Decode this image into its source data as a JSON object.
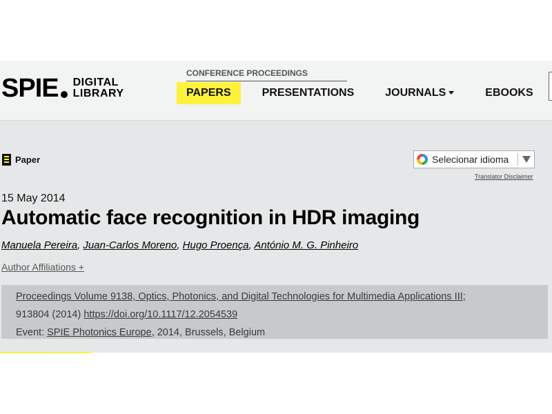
{
  "logo": {
    "main": "SPIE",
    "sub_line1": "DIGITAL",
    "sub_line2": "LIBRARY"
  },
  "header": {
    "conference_label": "CONFERENCE PROCEEDINGS",
    "nav": [
      {
        "label": "PAPERS",
        "active": true
      },
      {
        "label": "PRESENTATIONS",
        "active": false
      },
      {
        "label": "JOURNALS",
        "active": false,
        "dropdown": true
      },
      {
        "label": "EBOOKS",
        "active": false
      }
    ]
  },
  "article": {
    "type_label": "Paper",
    "date": "15 May 2014",
    "title": "Automatic face recognition in HDR imaging",
    "authors": [
      "Manuela Pereira",
      "Juan-Carlos Moreno",
      "Hugo Proença",
      "António M. G. Pinheiro"
    ],
    "author_separator": ", ",
    "affiliations_link": "Author Affiliations +"
  },
  "translate": {
    "label": "Selecionar idioma",
    "disclaimer": "Translator Disclaimer"
  },
  "proceedings": {
    "volume_link": "Proceedings Volume 9138, Optics, Photonics, and Digital Technologies for Multimedia Applications III;",
    "article_id": "913804 (2014) ",
    "doi_link": "https://doi.org/10.1117/12.2054539",
    "event_prefix": "Event: ",
    "event_link": "SPIE Photonics Europe",
    "event_suffix": ", 2014, Brussels, Belgium"
  },
  "colors": {
    "accent": "#fff23d",
    "header_bg": "#f2f3f3",
    "main_bg": "#e6e7e8",
    "proc_bg": "#c8c9cb"
  }
}
